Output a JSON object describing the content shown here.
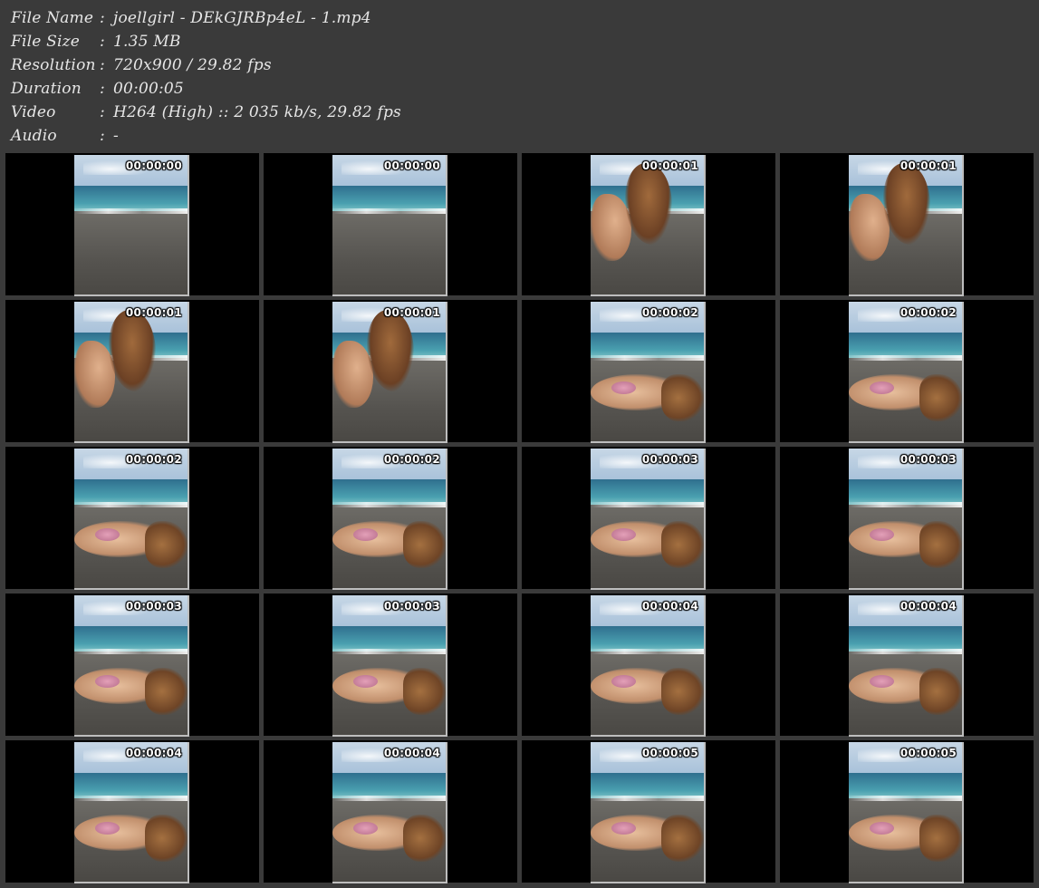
{
  "metadata": {
    "file_name": {
      "label": "File Name",
      "sep": ":",
      "value": "joellgirl - DEkGJRBp4eL - 1.mp4"
    },
    "file_size": {
      "label": "File Size",
      "sep": ":",
      "value": "1.35 MB"
    },
    "resolution": {
      "label": "Resolution",
      "sep": ":",
      "value": "720x900 / 29.82 fps"
    },
    "duration": {
      "label": "Duration",
      "sep": ":",
      "value": "00:00:05"
    },
    "video": {
      "label": "Video",
      "sep": ":",
      "value": "H264 (High) :: 2 035 kb/s, 29.82 fps"
    },
    "audio": {
      "label": "Audio",
      "sep": ":",
      "value": "-"
    }
  },
  "thumbnails": [
    {
      "timestamp": "00:00:00",
      "scene": "beach-empty"
    },
    {
      "timestamp": "00:00:00",
      "scene": "beach-empty"
    },
    {
      "timestamp": "00:00:01",
      "scene": "hair-flip"
    },
    {
      "timestamp": "00:00:01",
      "scene": "hair-flip"
    },
    {
      "timestamp": "00:00:01",
      "scene": "hair-flip"
    },
    {
      "timestamp": "00:00:01",
      "scene": "hair-flip"
    },
    {
      "timestamp": "00:00:02",
      "scene": "lying"
    },
    {
      "timestamp": "00:00:02",
      "scene": "lying"
    },
    {
      "timestamp": "00:00:02",
      "scene": "lying"
    },
    {
      "timestamp": "00:00:02",
      "scene": "lying"
    },
    {
      "timestamp": "00:00:03",
      "scene": "lying"
    },
    {
      "timestamp": "00:00:03",
      "scene": "lying"
    },
    {
      "timestamp": "00:00:03",
      "scene": "lying"
    },
    {
      "timestamp": "00:00:03",
      "scene": "lying"
    },
    {
      "timestamp": "00:00:04",
      "scene": "lying"
    },
    {
      "timestamp": "00:00:04",
      "scene": "lying"
    },
    {
      "timestamp": "00:00:04",
      "scene": "lying"
    },
    {
      "timestamp": "00:00:04",
      "scene": "lying"
    },
    {
      "timestamp": "00:00:05",
      "scene": "lying"
    },
    {
      "timestamp": "00:00:05",
      "scene": "lying"
    }
  ],
  "colors": {
    "background": "#3a3a3a",
    "cell_background": "#000000",
    "text": "#e6e6e6",
    "timestamp": "#ffffff"
  }
}
